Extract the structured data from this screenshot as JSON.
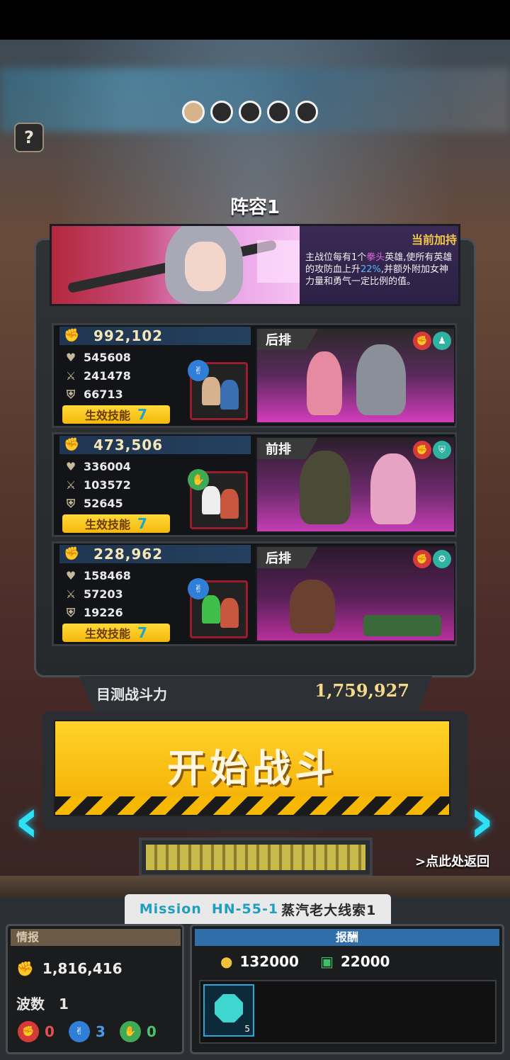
{
  "pager": {
    "count": 5,
    "active": 0
  },
  "help_label": "?",
  "team_title": "阵容1",
  "banner": {
    "bonus_title": "当前加持",
    "bonus_text_1": "主战位每有1个",
    "bonus_hero_type": "拳头",
    "bonus_text_2": "英雄,使所有英雄的攻防血上升",
    "bonus_pct": "22%",
    "bonus_text_3": ",并额外附加女神力量和勇气一定比例的值。"
  },
  "heroes": [
    {
      "power": "992,102",
      "hp": "545608",
      "atk": "241478",
      "def": "66713",
      "skill_label": "生效技能",
      "skill_count": "7",
      "position": "后排",
      "badge_color": "#2f7fd8"
    },
    {
      "power": "473,506",
      "hp": "336004",
      "atk": "103572",
      "def": "52645",
      "skill_label": "生效技能",
      "skill_count": "7",
      "position": "前排",
      "badge_color": "#3faa55"
    },
    {
      "power": "228,962",
      "hp": "158468",
      "atk": "57203",
      "def": "19226",
      "skill_label": "生效技能",
      "skill_count": "7",
      "position": "后排",
      "badge_color": "#2f7fd8"
    }
  ],
  "estimate": {
    "label": "目测战斗力",
    "value": "1,759,927"
  },
  "start_button": "开始战斗",
  "back_link": ">点此处返回",
  "mission": {
    "prefix": "Mission",
    "code": "HN-55-1",
    "name": "蒸汽老大线索1"
  },
  "intel": {
    "title": "情报",
    "power": "1,816,416",
    "wave_label": "波数",
    "wave_value": "1",
    "types": [
      {
        "name": "fist",
        "color": "#d83a3a",
        "count": "0"
      },
      {
        "name": "scissors",
        "color": "#2f7fd8",
        "count": "3"
      },
      {
        "name": "palm",
        "color": "#3faa55",
        "count": "0"
      }
    ]
  },
  "reward": {
    "title": "报酬",
    "gold": "132000",
    "cash": "22000",
    "item_count": "5"
  },
  "colors": {
    "accent": "#f7b80d",
    "arrow": "#2de0f4",
    "gem": "#3fd6d0"
  },
  "icons": {
    "power": "fist-icon",
    "hp": "heart-icon",
    "atk": "sword-icon",
    "def": "shield-icon",
    "gold": "coin-icon",
    "cash": "cash-icon"
  }
}
